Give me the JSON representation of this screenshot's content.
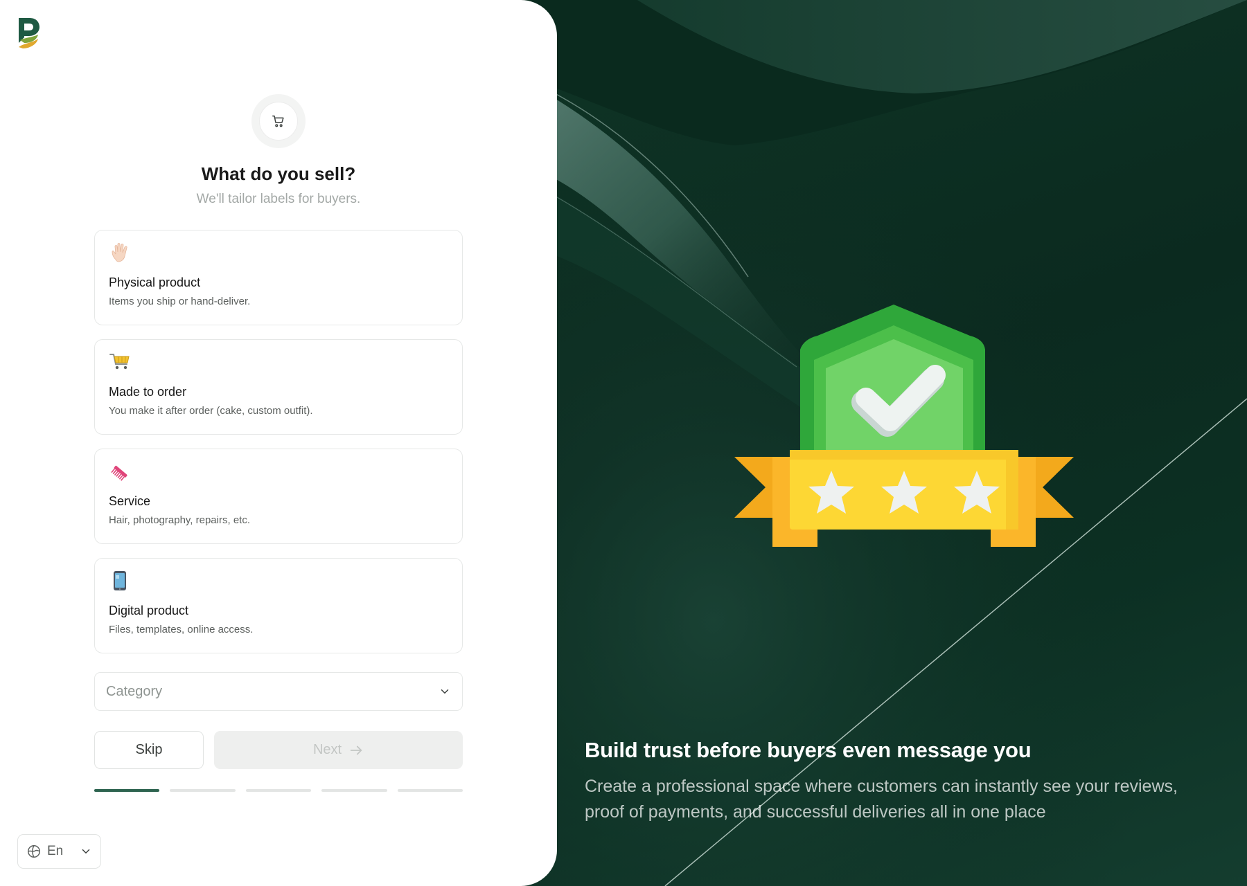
{
  "header": {
    "title": "What do you sell?",
    "subtitle": "We'll tailor labels for buyers."
  },
  "options": [
    {
      "title": "Physical product",
      "description": "Items you ship or hand-deliver.",
      "icon": "hand-icon"
    },
    {
      "title": "Made to order",
      "description": "You make it after order (cake, custom outfit).",
      "icon": "shopping-cart-icon"
    },
    {
      "title": "Service",
      "description": "Hair, photography, repairs, etc.",
      "icon": "comb-icon"
    },
    {
      "title": "Digital product",
      "description": "Files, templates, online access.",
      "icon": "mobile-phone-icon"
    }
  ],
  "category": {
    "placeholder": "Category"
  },
  "actions": {
    "skip_label": "Skip",
    "next_label": "Next"
  },
  "progress": {
    "current_step": 1,
    "total_steps": 5
  },
  "language": {
    "label": "En"
  },
  "hero": {
    "title": "Build trust before buyers even message you",
    "subtitle": "Create a professional space where customers can instantly see your reviews, proof of payments, and successful deliveries all in one place"
  },
  "colors": {
    "brand_green": "#1f5a43",
    "brand_gold": "#e0a82e",
    "hero_background": "#0b2a1f",
    "progress_active": "#2e6450"
  }
}
